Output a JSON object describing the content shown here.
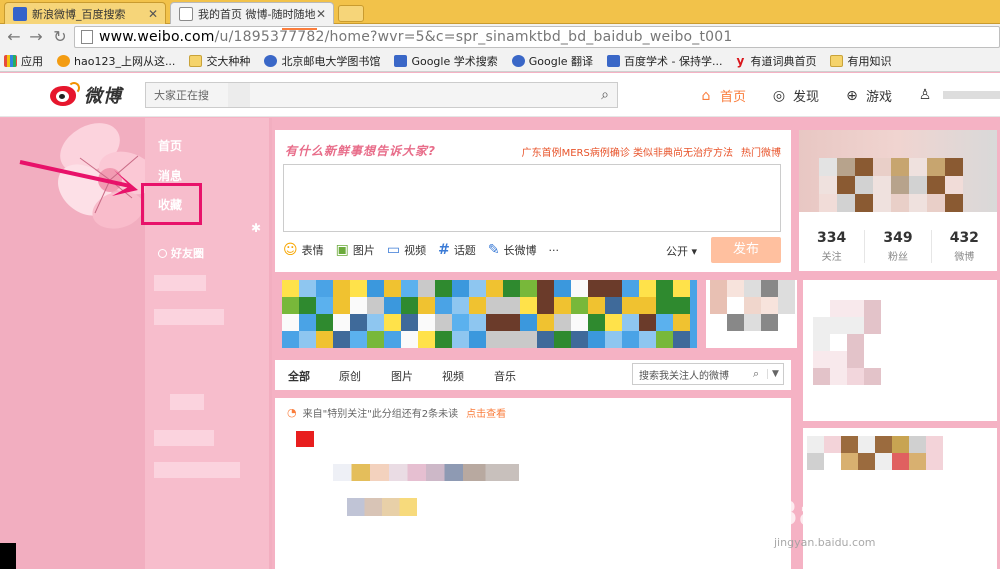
{
  "browser": {
    "tabs": [
      {
        "title": "新浪微博_百度搜索",
        "active": false
      },
      {
        "title": "我的首页 微博-随时随地分享",
        "active": true
      }
    ],
    "url_host": "www.weibo.com",
    "url_rest": "/u/1895377782/home?wvr=5&c=spr_sinamktbd_bd_baidub_weibo_t001",
    "bookmarks": [
      {
        "label": "应用",
        "icon": "apps-grid-icon"
      },
      {
        "label": "hao123_上网从这...",
        "icon": "hao123-icon"
      },
      {
        "label": "交大种种",
        "icon": "folder-icon"
      },
      {
        "label": "北京邮电大学图书馆",
        "icon": "globe-icon"
      },
      {
        "label": "Google 学术搜索",
        "icon": "google-scholar-icon"
      },
      {
        "label": "Google 翻译",
        "icon": "paw-icon"
      },
      {
        "label": "百度学术 - 保持学...",
        "icon": "baidu-paw-icon"
      },
      {
        "label": "有道词典首页",
        "icon": "youdao-icon"
      },
      {
        "label": "有用知识",
        "icon": "folder-icon"
      }
    ]
  },
  "header": {
    "logo_text": "微博",
    "search_placeholder": "大家正在搜",
    "nav": {
      "home": "首页",
      "discover": "发现",
      "game": "游戏"
    }
  },
  "leftnav": {
    "home": "首页",
    "messages": "消息",
    "favorites": "收藏",
    "friends": "好友圈"
  },
  "publisher": {
    "prompt": "有什么新鲜事想告诉大家?",
    "hot_topic": "广东首例MERS病例确诊 类似非典尚无治疗方法",
    "hot_tag": "热门微博",
    "tools": {
      "emoji": "表情",
      "picture": "图片",
      "video": "视频",
      "topic": "话题",
      "long": "长微博",
      "more": "···"
    },
    "visibility": "公开",
    "send": "发布"
  },
  "feed": {
    "tabs": [
      "全部",
      "原创",
      "图片",
      "视频",
      "音乐"
    ],
    "search_placeholder": "搜索我关注人的微博",
    "notice_text": "来自\"特别关注\"此分组还有2条未读",
    "notice_link": "点击查看"
  },
  "profile": {
    "stats": [
      {
        "value": "334",
        "label": "关注"
      },
      {
        "value": "349",
        "label": "粉丝"
      },
      {
        "value": "432",
        "label": "微博"
      }
    ]
  },
  "watermark": {
    "big": "Baidu经验",
    "small": "jingyan.baidu.com"
  },
  "colors": {
    "weibo_red": "#e6162d",
    "accent_orange": "#fa7d3c",
    "pink_bg": "#f5b2c4",
    "highlight": "#e8126a"
  }
}
